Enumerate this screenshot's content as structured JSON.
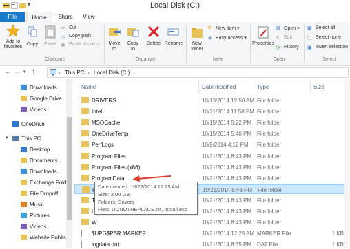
{
  "window": {
    "title": "Local Disk (C:)"
  },
  "tabs": {
    "file": "File",
    "home": "Home",
    "share": "Share",
    "view": "View"
  },
  "ribbon": {
    "add_to_favorites": "Add to favorites",
    "copy": "Copy",
    "paste": "Paste",
    "cut": "Cut",
    "copy_path": "Copy path",
    "paste_shortcut": "Paste shortcut",
    "clipboard": "Clipboard",
    "move_to": "Move to",
    "copy_to": "Copy to",
    "delete": "Delete",
    "rename": "Rename",
    "organize": "Organize",
    "new_folder": "New folder",
    "new_item": "New item ▾",
    "easy_access": "Easy access ▾",
    "new": "New",
    "properties": "Properties",
    "open": "Open ▾",
    "edit": "Edit",
    "history": "History",
    "open_group": "Open",
    "select_all": "Select all",
    "select_none": "Select none",
    "invert_selection": "Invert selection",
    "select": "Select"
  },
  "address": {
    "this_pc": "This PC",
    "sep1": "›",
    "local_disk": "Local Disk (C:)",
    "sep2": "›",
    "sep0": "›"
  },
  "nav": {
    "items": [
      "Downloads",
      "Google Drive",
      "Videos",
      "OneDrive",
      "This PC",
      "Desktop",
      "Documents",
      "Downloads",
      "Exchange Fold",
      "File Dropoff",
      "Music",
      "Pictures",
      "Videos",
      "Website Publis"
    ]
  },
  "columns": {
    "name": "Name",
    "date": "Date modified",
    "type": "Type",
    "size": "Size"
  },
  "files": [
    {
      "name": "DRIVERS",
      "date": "10/13/2014 12:50 AM",
      "type": "File folder",
      "size": ""
    },
    {
      "name": "Intel",
      "date": "10/21/2014 11:58 PM",
      "type": "File folder",
      "size": ""
    },
    {
      "name": "MSOCache",
      "date": "10/15/2014 5:22 PM",
      "type": "File folder",
      "size": ""
    },
    {
      "name": "OneDriveTemp",
      "date": "10/15/2014 5:40 PM",
      "type": "File folder",
      "size": ""
    },
    {
      "name": "PerfLogs",
      "date": "10/9/2014 4:12 PM",
      "type": "File folder",
      "size": ""
    },
    {
      "name": "Program Files",
      "date": "10/21/2014 8:43 PM",
      "type": "File folder",
      "size": ""
    },
    {
      "name": "Program Files (x86)",
      "date": "10/21/2014 8:43 PM",
      "type": "File folder",
      "size": ""
    },
    {
      "name": "ProgramData",
      "date": "10/21/2014 8:43 PM",
      "type": "File folder",
      "size": ""
    },
    {
      "name": "RecoveryImage",
      "date": "10/21/2014 8:48 PM",
      "type": "File folder",
      "size": ""
    },
    {
      "name": "Te",
      "date": "10/21/2014 8:43 PM",
      "type": "File folder",
      "size": ""
    },
    {
      "name": "U",
      "date": "10/21/2014 8:43 PM",
      "type": "File folder",
      "size": ""
    },
    {
      "name": "W",
      "date": "10/21/2014 8:43 PM",
      "type": "File folder",
      "size": ""
    },
    {
      "name": "$UPG$PBR.MARKER",
      "date": "10/21/2014 12:25 AM",
      "type": "MARKER File",
      "size": "1 KB"
    },
    {
      "name": "logdata.dat",
      "date": "10/21/2014 8:35 PM",
      "type": "DAT File",
      "size": "1 KB"
    }
  ],
  "tooltip": {
    "created": "Date created: 10/22/2014 12:25 AM",
    "size": "Size: 3.00 GB",
    "folders": "Folders: Drivers",
    "files": "Files: DONOTREPLACE.txt, Install.esd"
  },
  "colors": {
    "accent": "#1979ca",
    "selection": "#cce8ff",
    "folder": "#e8c35a",
    "arrow": "#e23b2e"
  }
}
